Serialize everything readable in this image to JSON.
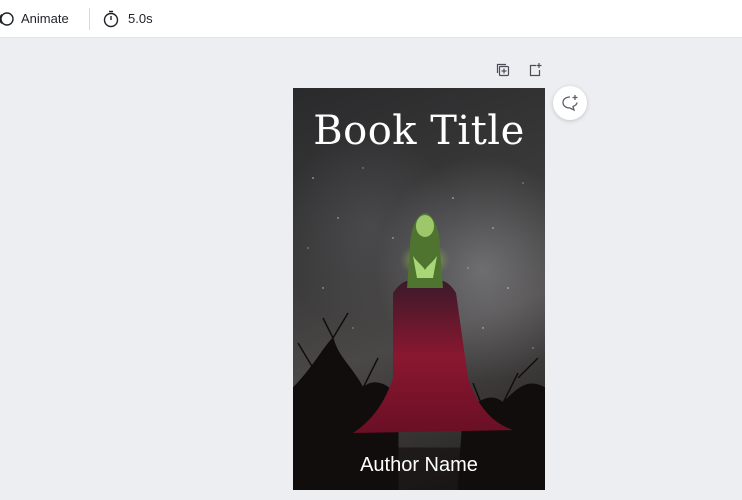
{
  "toolbar": {
    "animate_label": "Animate",
    "duration_label": "5.0s"
  },
  "page": {
    "actions": [
      "duplicate-page-icon",
      "add-page-icon"
    ],
    "comment_icon": "add-comment-icon"
  },
  "cover": {
    "title": "Book Title",
    "author": "Author Name"
  }
}
